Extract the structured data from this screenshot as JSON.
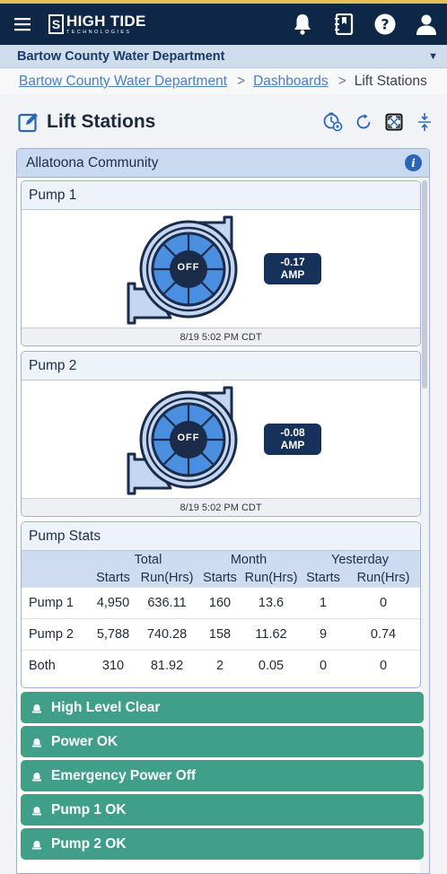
{
  "header": {
    "logo_main": "HIGH TIDE",
    "logo_sub": "TECHNOLOGIES",
    "logo_mark": "S"
  },
  "org": {
    "name": "Bartow County Water Department",
    "caret": "▼"
  },
  "breadcrumb": {
    "items": [
      "Bartow County Water Department",
      "Dashboards"
    ],
    "current": "Lift Stations",
    "separator": ">"
  },
  "page": {
    "title": "Lift Stations"
  },
  "station": {
    "name": "Allatoona Community",
    "info": "i",
    "pumps": [
      {
        "name": "Pump 1",
        "state": "OFF",
        "amp_value": "-0.17",
        "amp_unit": "AMP",
        "timestamp": "8/19 5:02 PM CDT"
      },
      {
        "name": "Pump 2",
        "state": "OFF",
        "amp_value": "-0.08",
        "amp_unit": "AMP",
        "timestamp": "8/19 5:02 PM CDT"
      }
    ],
    "stats": {
      "title": "Pump Stats",
      "groups": [
        "Total",
        "Month",
        "Yesterday"
      ],
      "cols": [
        "Starts",
        "Run(Hrs)",
        "Starts",
        "Run(Hrs)",
        "Starts",
        "Run(Hrs)"
      ],
      "rows": [
        {
          "label": "Pump 1",
          "cells": [
            "4,950",
            "636.11",
            "160",
            "13.6",
            "1",
            "0"
          ]
        },
        {
          "label": "Pump 2",
          "cells": [
            "5,788",
            "740.28",
            "158",
            "11.62",
            "9",
            "0.74"
          ]
        },
        {
          "label": "Both",
          "cells": [
            "310",
            "81.92",
            "2",
            "0.05",
            "0",
            "0"
          ]
        }
      ]
    },
    "alarms": [
      "High Level Clear",
      "Power OK",
      "Emergency Power Off",
      "Pump 1 OK",
      "Pump 2 OK"
    ]
  },
  "colors": {
    "topbar": "#0f2746",
    "accent_line": "#e4c05a",
    "alarm_ok": "#3f9f88",
    "amp_badge": "#16315a",
    "impeller": "#4a8fe0"
  }
}
